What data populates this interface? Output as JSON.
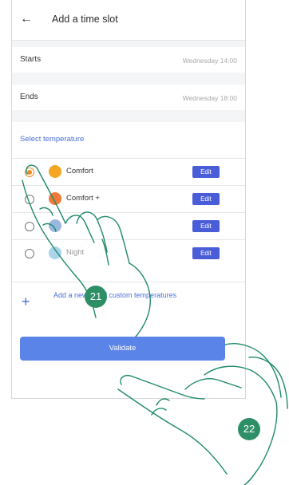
{
  "header": {
    "title": "Add a time slot",
    "back_icon": "arrow-left-icon"
  },
  "schedule": {
    "starts_label": "Starts",
    "starts_value": "Wednesday 14:00",
    "ends_label": "Ends",
    "ends_value": "Wednesday 18:00"
  },
  "temperature": {
    "section_title": "Select temperature",
    "items": [
      {
        "name": "Comfort",
        "selected": true,
        "icon_color": "#f5a623",
        "edit_label": "Edit"
      },
      {
        "name": "Comfort +",
        "selected": false,
        "icon_color": "#f07a3a",
        "edit_label": "Edit"
      },
      {
        "name": "",
        "selected": false,
        "icon_color": "#9ab7e0",
        "edit_label": "Edit"
      },
      {
        "name": "Night",
        "selected": false,
        "icon_color": "#a9d4ec",
        "edit_label": "Edit"
      }
    ],
    "add_custom_label": "Add a new set of custom temperatures"
  },
  "actions": {
    "validate_label": "Validate"
  },
  "steps": {
    "step_a": "21",
    "step_b": "22"
  },
  "colors": {
    "accent": "#4a6fd8",
    "selected": "#f08a24",
    "button": "#5b84e8",
    "badge": "#2e8f66"
  }
}
